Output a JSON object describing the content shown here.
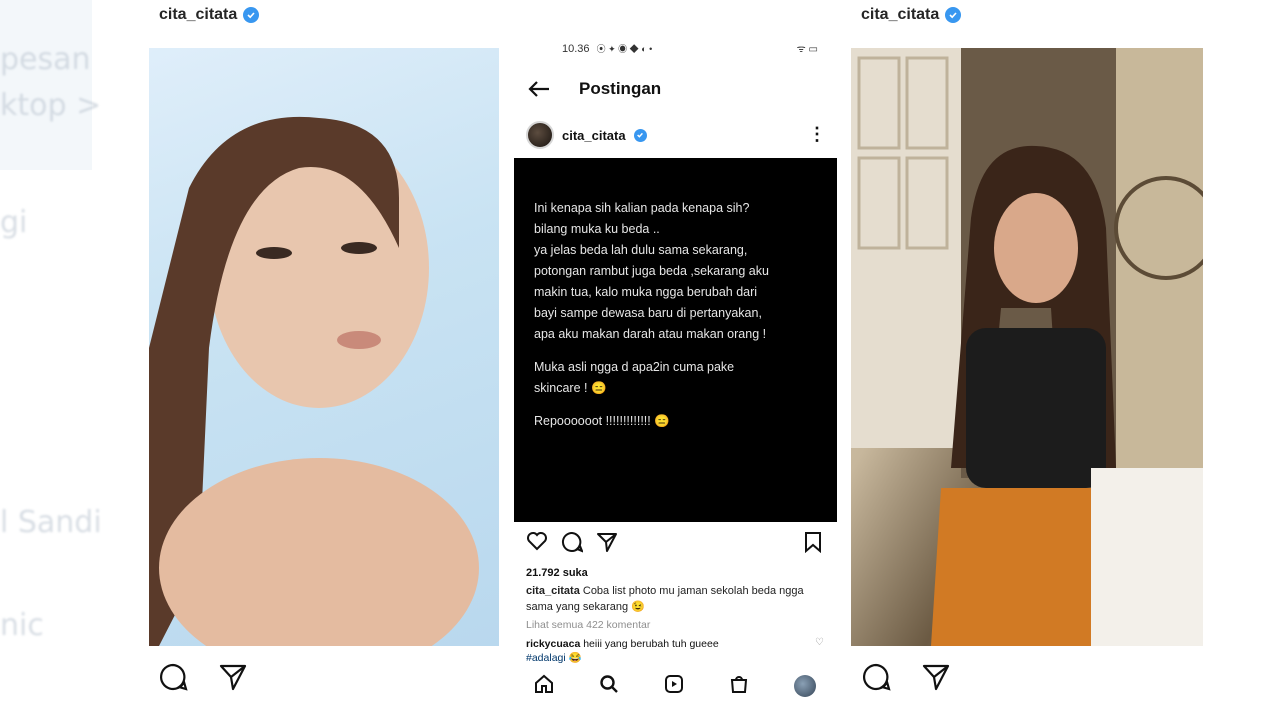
{
  "background_fragments": [
    "pesan",
    "ktop >",
    "gi",
    "l Sandi",
    "nic"
  ],
  "left_post": {
    "username": "cita_citata",
    "verified": true,
    "icons": [
      "comment-icon",
      "share-icon"
    ]
  },
  "right_post": {
    "username": "cita_citata",
    "verified": true,
    "icons": [
      "comment-icon",
      "share-icon"
    ]
  },
  "phone": {
    "status_bar": {
      "time": "10.36",
      "notification_icons": "⦿ ✦ ◉ ◆ ◐ •",
      "signal_icons": "ᯤ ▭"
    },
    "header": {
      "back_icon": "arrow-left-icon",
      "title": "Postingan"
    },
    "author": {
      "username": "cita_citata",
      "verified": true
    },
    "quote": {
      "paragraph1": "Ini kenapa sih kalian pada kenapa sih?\nbilang muka ku beda ..\nya jelas beda lah dulu sama sekarang,\npotongan rambut juga beda ,sekarang aku\nmakin tua, kalo muka ngga berubah dari\nbayi sampe dewasa baru di pertanyakan,\napa aku makan darah atau makan orang !",
      "paragraph2": "Muka asli ngga d apa2in cuma pake\nskincare ! 😑",
      "paragraph3": "Repoooooot  !!!!!!!!!!!!! 😑"
    },
    "likes": "21.792 suka",
    "caption": {
      "username": "cita_citata",
      "text": "Coba list photo mu jaman sekolah beda ngga sama yang sekarang 😉"
    },
    "view_comments": "Lihat semua 422 komentar",
    "comment": {
      "username": "rickycuaca",
      "text": "heiii yang berubah tuh gueee",
      "tag": "#adalagi 😂"
    },
    "bottom_nav": [
      "home-icon",
      "search-icon",
      "reels-icon",
      "shop-icon",
      "profile-avatar"
    ]
  }
}
